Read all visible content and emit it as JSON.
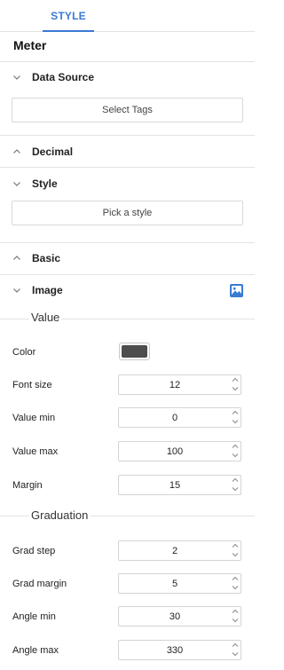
{
  "tabs": [
    {
      "label": "STYLE"
    }
  ],
  "panel": {
    "title": "Meter"
  },
  "sections": {
    "data_source": {
      "label": "Data Source",
      "button": "Select Tags"
    },
    "decimal": {
      "label": "Decimal"
    },
    "style": {
      "label": "Style",
      "button": "Pick a style"
    },
    "basic": {
      "label": "Basic"
    },
    "image": {
      "label": "Image",
      "icon": "image-icon"
    }
  },
  "value_group": {
    "title": "Value",
    "color_label": "Color",
    "color_value": "#4d4d4d",
    "fields": [
      {
        "label": "Font size",
        "value": "12"
      },
      {
        "label": "Value min",
        "value": "0"
      },
      {
        "label": "Value max",
        "value": "100"
      },
      {
        "label": "Margin",
        "value": "15"
      }
    ]
  },
  "graduation_group": {
    "title": "Graduation",
    "fields": [
      {
        "label": "Grad step",
        "value": "2"
      },
      {
        "label": "Grad margin",
        "value": "5"
      },
      {
        "label": "Angle min",
        "value": "30"
      },
      {
        "label": "Angle max",
        "value": "330"
      }
    ]
  },
  "colors": {
    "accent": "#3a7bd5",
    "border": "#d9d9d9",
    "divider": "#e3e3e3"
  }
}
